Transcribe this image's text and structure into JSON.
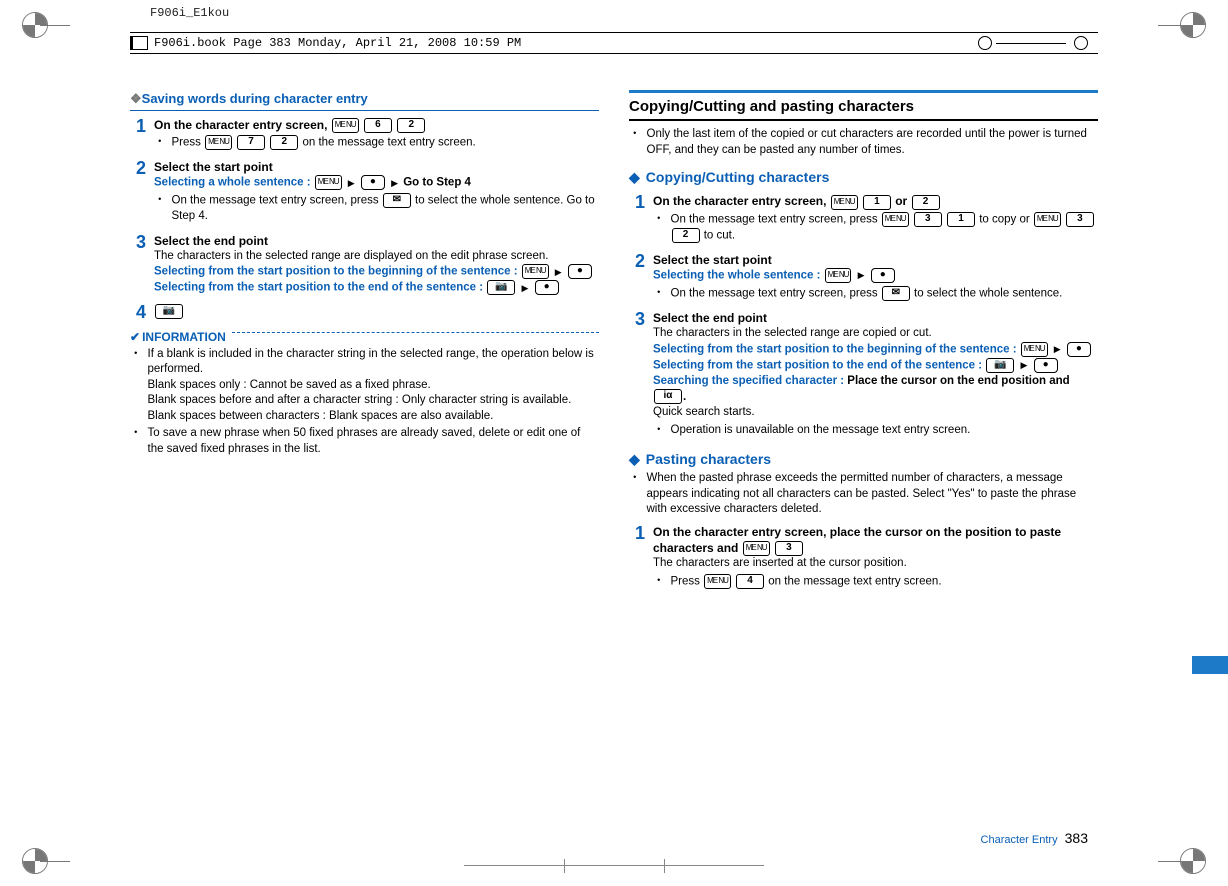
{
  "meta": {
    "label1": "F906i_E1kou",
    "label2": "F906i.book  Page 383  Monday, April 21, 2008  10:59 PM"
  },
  "footer": {
    "section": "Character Entry",
    "page": "383"
  },
  "keys": {
    "menu": "ME\nNU",
    "k1": "1",
    "k2": "2",
    "k3": "3",
    "k4": "4",
    "k6": "6",
    "k7": "7",
    "center": "●",
    "mail": "✉",
    "camera": "📷",
    "iapp": "iα",
    "arrow": "▶"
  },
  "left": {
    "saving_header": "Saving words during character entry",
    "step1_title_a": "On the character entry screen, ",
    "step1_b1_a": "Press ",
    "step1_b1_b": " on the message text entry screen.",
    "step2_title": "Select the start point",
    "step2_sel_label": "Selecting a whole sentence : ",
    "step2_sel_tail": "Go to Step 4",
    "step2_b1_a": "On the message text entry screen, press ",
    "step2_b1_b": " to select the whole sentence. Go to Step 4.",
    "step3_title": "Select the end point",
    "step3_body": "The characters in the selected range are displayed on the edit phrase screen.",
    "step3_sel1": "Selecting from the start position to the beginning of the sentence : ",
    "step3_sel2": "Selecting from the start position to the end of the sentence : ",
    "info_title": "INFORMATION",
    "info1": "If a blank is included in the character string in the selected range, the operation below is performed.",
    "info1a": "Blank spaces only : Cannot be saved as a fixed phrase.",
    "info1b": "Blank spaces before and after a character string : Only character string is available.",
    "info1c": "Blank spaces between characters : Blank spaces are also available.",
    "info2": "To save a new phrase when 50 fixed phrases are already saved, delete or edit one of the saved fixed phrases in the list."
  },
  "right": {
    "header": "Copying/Cutting and pasting characters",
    "intro": "Only the last item of the copied or cut characters are recorded until the power is turned OFF, and they can be pasted any number of times.",
    "copy_header": "Copying/Cutting characters",
    "c_step1_t_a": "On the character entry screen, ",
    "c_step1_t_or": " or ",
    "c_step1_b_a": "On the message text entry screen, press ",
    "c_step1_b_mid": " to copy or ",
    "c_step1_b_tail": " to cut.",
    "c_step2_title": "Select the start point",
    "c_step2_sel": "Selecting the whole sentence : ",
    "c_step2_b_a": "On the message text entry screen, press ",
    "c_step2_b_b": " to select the whole sentence.",
    "c_step3_title": "Select the end point",
    "c_step3_body": "The characters in the selected range are copied or cut.",
    "c_step3_sel1": "Selecting from the start position to the beginning of the sentence : ",
    "c_step3_sel2": "Selecting from the start position to the end of the sentence : ",
    "c_step3_sel3_a": "Searching the specified character : ",
    "c_step3_sel3_b": "Place the cursor on the end position and ",
    "c_step3_sel3_c": ".",
    "c_step3_body2": "Quick search starts.",
    "c_step3_b1": "Operation is unavailable on the message text entry screen.",
    "paste_header": "Pasting characters",
    "paste_intro": "When the pasted phrase exceeds the permitted number of characters, a message appears indicating not all characters can be pasted. Select \"Yes\" to paste the phrase with excessive characters deleted.",
    "p_step1_t_a": "On the character entry screen, place the cursor on the position to paste characters and ",
    "p_step1_body": "The characters are inserted at the cursor position.",
    "p_step1_b_a": "Press ",
    "p_step1_b_b": " on the message text entry screen."
  }
}
